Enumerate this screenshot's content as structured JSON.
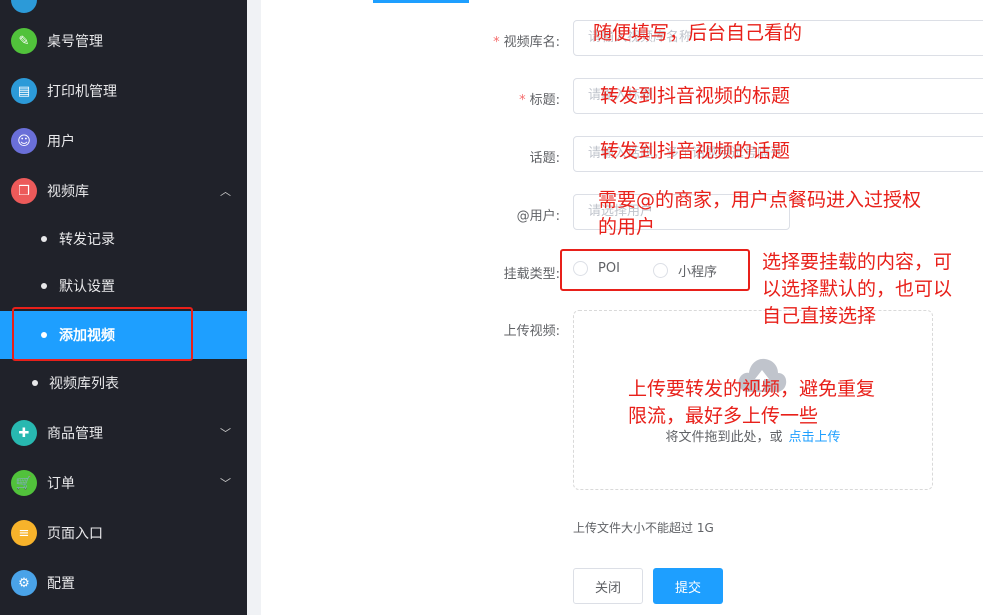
{
  "sidebar": {
    "items": [
      {
        "label": "桌号管理",
        "icon": "table-icon",
        "color": "#51c23b"
      },
      {
        "label": "打印机管理",
        "icon": "printer-icon",
        "color": "#2c9ad8"
      },
      {
        "label": "用户",
        "icon": "users-icon",
        "color": "#6a6fd8"
      },
      {
        "label": "视频库",
        "icon": "box-icon",
        "color": "#ec5a5a"
      },
      {
        "label": "商品管理",
        "icon": "bag-icon",
        "color": "#28b8b0"
      },
      {
        "label": "订单",
        "icon": "cart-icon",
        "color": "#51c23b"
      },
      {
        "label": "页面入口",
        "icon": "database-icon",
        "color": "#f7b32b"
      },
      {
        "label": "配置",
        "icon": "gears-icon",
        "color": "#4aa3e8"
      }
    ],
    "sub_items": [
      {
        "label": "转发记录"
      },
      {
        "label": "默认设置"
      },
      {
        "label": "添加视频",
        "active": true
      },
      {
        "label": "视频库列表"
      }
    ]
  },
  "form": {
    "library_name": {
      "label": "视频库名:",
      "placeholder": "请输入视频库名称"
    },
    "title": {
      "label": "标题:",
      "placeholder": "请输入标题"
    },
    "topic": {
      "label": "话题:",
      "placeholder": "请输入话题，多个话题用逗号隔开"
    },
    "at_user": {
      "label": "@用户:",
      "placeholder": "请选择用户"
    },
    "mount_type": {
      "label": "挂载类型:",
      "options": [
        "POI",
        "小程序"
      ]
    },
    "upload": {
      "label": "上传视频:",
      "drag_text": "将文件拖到此处，或",
      "click_text": "点击上传",
      "tip": "上传文件大小不能超过 1G"
    },
    "buttons": {
      "close": "关闭",
      "submit": "提交"
    }
  },
  "annotations": {
    "library_name": "随便填写，后台自己看的",
    "title": "转发到抖音视频的标题",
    "topic": "转发到抖音视频的话题",
    "at_user_1": "需要@的商家，用户点餐码进入过授权",
    "at_user_2": "的用户",
    "mount_1": "选择要挂载的内容，可",
    "mount_2": "以选择默认的，也可以",
    "mount_3": "自己直接选择",
    "upload_1": "上传要转发的视频，避免重复",
    "upload_2": "限流，最好多上传一些"
  }
}
